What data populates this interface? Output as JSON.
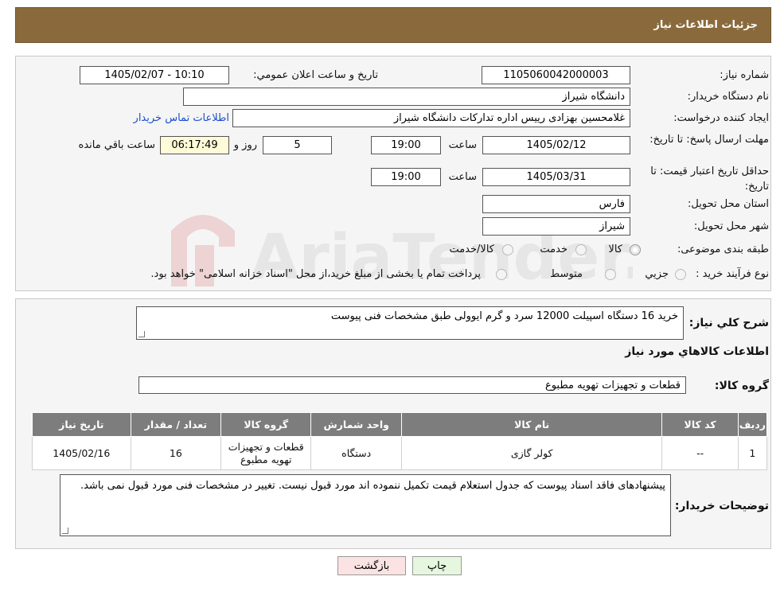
{
  "header": {
    "title": "جزئيات اطلاعات نياز"
  },
  "fields": {
    "need_number_label": "شماره نیاز:",
    "need_number": "1105060042000003",
    "announce_label": "تاريخ و ساعت اعلان عمومي:",
    "announce_value": "1405/02/07 - 10:10",
    "buyer_org_label": "نام دستگاه خريدار:",
    "buyer_org": "دانشگاه شیراز",
    "creator_label": "ايجاد كننده درخواست:",
    "creator": "غلامحسین بهزادی رییس اداره تدارکات دانشگاه شیراز",
    "contact_link": "اطلاعات تماس خريدار",
    "deadline_label": "مهلت ارسال پاسخ: تا تاريخ:",
    "deadline_date": "1405/02/12",
    "time_label": "ساعت",
    "deadline_time": "19:00",
    "days_value": "5",
    "days_label": "روز و",
    "remaining_time": "06:17:49",
    "remaining_label": "ساعت باقي مانده",
    "min_validity_label": "حداقل تاريخ اعتبار قيمت: تا تاريخ:",
    "validity_date": "1405/03/31",
    "validity_time": "19:00",
    "province_label": "استان محل تحويل:",
    "province": "فارس",
    "city_label": "شهر محل تحويل:",
    "city": "شیراز",
    "category_label": "طبقه بندی موضوعی:",
    "category_options": [
      "كالا",
      "خدمت",
      "كالا/خدمت"
    ],
    "purchase_type_label": "نوع فرآيند خريد :",
    "purchase_options": [
      "جزيي",
      "متوسط"
    ],
    "purchase_note": "پرداخت تمام يا بخشی از مبلغ خريد،از محل \"اسناد خزانه اسلامی\" خواهد بود."
  },
  "summary": {
    "label": "شرح كلي نياز:",
    "text": "خرید 16 دستگاه اسپیلت 12000 سرد و گرم ایوولی طبق مشخصات فنی پیوست",
    "goods_info_title": "اطلاعات كالاهاي مورد نياز",
    "goods_group_label": "گروه كالا:",
    "goods_group": "قطعات و تجهیزات تهویه مطبوع"
  },
  "table": {
    "headers": [
      "رديف",
      "كد كالا",
      "نام كالا",
      "واحد شمارش",
      "گروه كالا",
      "تعداد / مقدار",
      "تاريخ نياز"
    ],
    "rows": [
      [
        "1",
        "--",
        "کولر گازی",
        "دستگاه",
        "قطعات و تجهیزات تهویه مطبوع",
        "16",
        "1405/02/16"
      ]
    ]
  },
  "buyer_notes": {
    "label": "توضيحات خريدار:",
    "text": "پیشنهادهای فاقد اسناد پیوست که جدول استعلام قیمت تکمیل ننموده اند مورد قبول نیست. تغییر در مشخصات فنی مورد قبول نمی باشد."
  },
  "buttons": {
    "print": "چاپ",
    "back": "بازگشت"
  },
  "watermark": {
    "text": "AriaTender.neT"
  },
  "colors": {
    "header_bg": "#8a6a3c",
    "table_header_bg": "#7d7d7d",
    "print_bg": "#e6f7df",
    "back_bg": "#fbe3e3",
    "link": "#1a4fcf"
  }
}
